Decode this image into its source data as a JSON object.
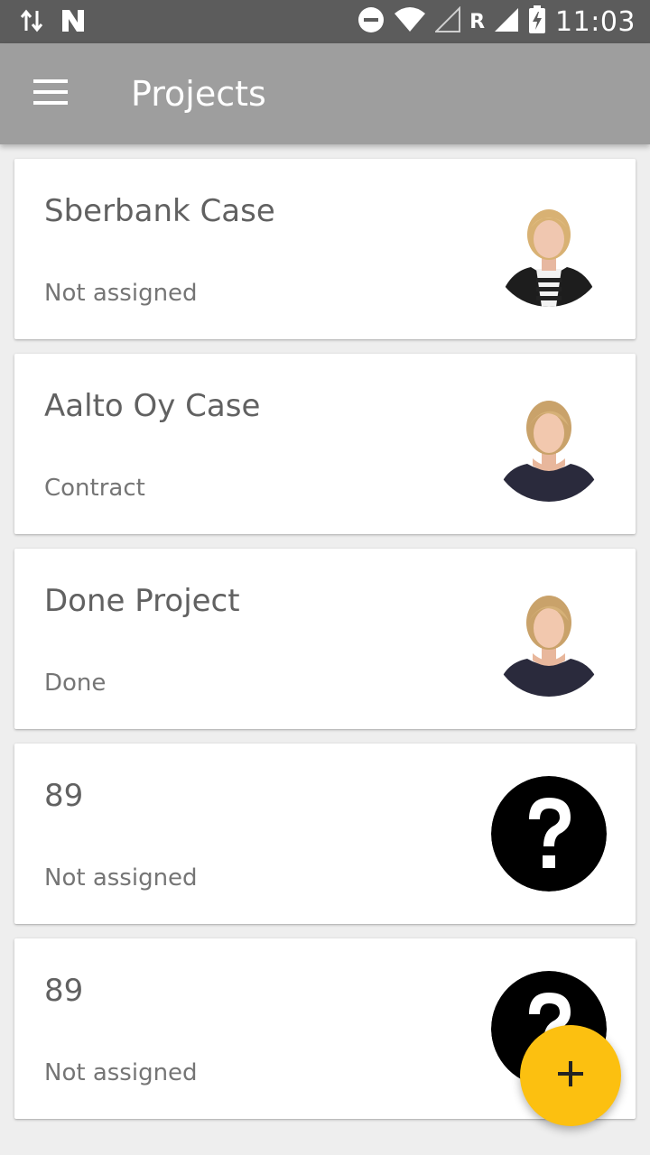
{
  "status_bar": {
    "time": "11:03",
    "network_label": "R",
    "icons": [
      "data-transfer-icon",
      "n-notification-icon",
      "do-not-disturb-icon",
      "wifi-icon",
      "signal-icon",
      "battery-charging-icon"
    ]
  },
  "app_bar": {
    "title": "Projects",
    "menu_icon": "hamburger-menu-icon",
    "color": "#9e9e9e"
  },
  "projects": [
    {
      "title": "Sberbank Case",
      "status": "Not assigned",
      "avatar": "person-photo-a"
    },
    {
      "title": "Aalto Oy Case",
      "status": "Contract",
      "avatar": "person-photo-b"
    },
    {
      "title": "Done Project",
      "status": "Done",
      "avatar": "person-photo-b"
    },
    {
      "title": "89",
      "status": "Not assigned",
      "avatar": "question-mark-icon"
    },
    {
      "title": "89",
      "status": "Not assigned",
      "avatar": "question-mark-icon"
    }
  ],
  "fab": {
    "icon": "plus-icon",
    "color": "#fcc010"
  }
}
